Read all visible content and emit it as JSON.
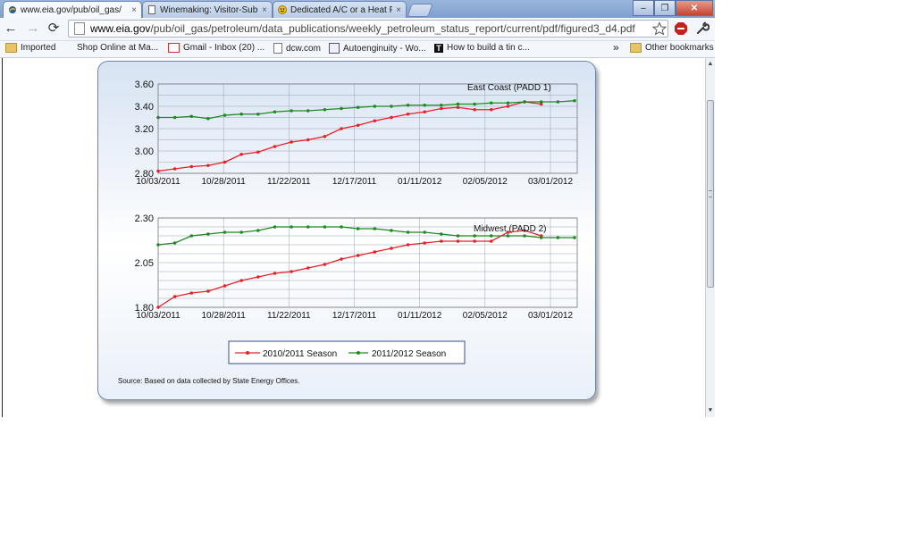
{
  "browser": {
    "tabs": [
      {
        "title": "www.eia.gov/pub/oil_gas/",
        "active": true,
        "icon": "eia-favicon"
      },
      {
        "title": "Winemaking: Visitor-Subm",
        "active": false,
        "icon": "page-favicon"
      },
      {
        "title": "Dedicated A/C or a Heat P",
        "active": false,
        "icon": "smiley-favicon"
      }
    ],
    "tab_close_glyph": "×",
    "window_buttons": {
      "minimize": "–",
      "maximize": "❐",
      "close": "✕"
    },
    "url_domain": "www.eia.gov",
    "url_path": "/pub/oil_gas/petroleum/data_publications/weekly_petroleum_status_report/current/pdf/figured3_d4.pdf",
    "nav_glyphs": {
      "back": "←",
      "forward": "→",
      "reload": "⟳"
    },
    "bookmarks": [
      {
        "label": "Imported",
        "icon": "folder-icon"
      },
      {
        "label": "Shop Online at Ma...",
        "icon": "none"
      },
      {
        "label": "Gmail - Inbox (20)  ...",
        "icon": "gmail-icon"
      },
      {
        "label": "dcw.com",
        "icon": "page-icon"
      },
      {
        "label": "Autoenginuity - Wo...",
        "icon": "box-icon"
      },
      {
        "label": "How to build a tin c...",
        "icon": "t-logo-icon"
      }
    ],
    "bookmarks_overflow": "»",
    "other_bookmarks": "Other bookmarks"
  },
  "chart_data": [
    {
      "type": "line",
      "title": "East Coast (PADD 1)",
      "ylim": [
        2.8,
        3.6
      ],
      "y_ticks": [
        "3.60",
        "3.40",
        "3.20",
        "3.00",
        "2.80"
      ],
      "y_tick_values": [
        3.6,
        3.4,
        3.2,
        3.0,
        2.8
      ],
      "x_ticks": [
        "10/03/2011",
        "10/28/2011",
        "11/22/2011",
        "12/17/2011",
        "01/11/2012",
        "02/05/2012",
        "03/01/2012"
      ],
      "series": [
        {
          "name": "2010/2011 Season",
          "color": "#e8202a",
          "values": [
            2.82,
            2.84,
            2.86,
            2.87,
            2.9,
            2.97,
            2.99,
            3.04,
            3.08,
            3.1,
            3.13,
            3.2,
            3.23,
            3.27,
            3.3,
            3.33,
            3.35,
            3.38,
            3.39,
            3.37,
            3.37,
            3.4,
            3.44,
            3.42
          ]
        },
        {
          "name": "2011/2012 Season",
          "color": "#1e8a22",
          "values": [
            3.3,
            3.3,
            3.31,
            3.29,
            3.32,
            3.33,
            3.33,
            3.35,
            3.36,
            3.36,
            3.37,
            3.38,
            3.39,
            3.4,
            3.4,
            3.41,
            3.41,
            3.41,
            3.42,
            3.42,
            3.43,
            3.43,
            3.44,
            3.44,
            3.44,
            3.45
          ]
        }
      ]
    },
    {
      "type": "line",
      "title": "Midwest (PADD 2)",
      "ylim": [
        1.8,
        2.3
      ],
      "y_ticks": [
        "2.30",
        "2.05",
        "1.80"
      ],
      "y_tick_values": [
        2.3,
        2.05,
        1.8
      ],
      "x_ticks": [
        "10/03/2011",
        "10/28/2011",
        "11/22/2011",
        "12/17/2011",
        "01/11/2012",
        "02/05/2012",
        "03/01/2012"
      ],
      "series": [
        {
          "name": "2010/2011 Season",
          "color": "#e8202a",
          "values": [
            1.8,
            1.86,
            1.88,
            1.89,
            1.92,
            1.95,
            1.97,
            1.99,
            2.0,
            2.02,
            2.04,
            2.07,
            2.09,
            2.11,
            2.13,
            2.15,
            2.16,
            2.17,
            2.17,
            2.17,
            2.17,
            2.22,
            2.23,
            2.2
          ]
        },
        {
          "name": "2011/2012 Season",
          "color": "#1e8a22",
          "values": [
            2.15,
            2.16,
            2.2,
            2.21,
            2.22,
            2.22,
            2.23,
            2.25,
            2.25,
            2.25,
            2.25,
            2.25,
            2.24,
            2.24,
            2.23,
            2.22,
            2.22,
            2.21,
            2.2,
            2.2,
            2.2,
            2.2,
            2.2,
            2.19,
            2.19,
            2.19
          ]
        }
      ]
    }
  ],
  "legend": [
    "2010/2011 Season",
    "2011/2012 Season"
  ],
  "source_note": "Source: Based on data collected by State Energy Offices."
}
